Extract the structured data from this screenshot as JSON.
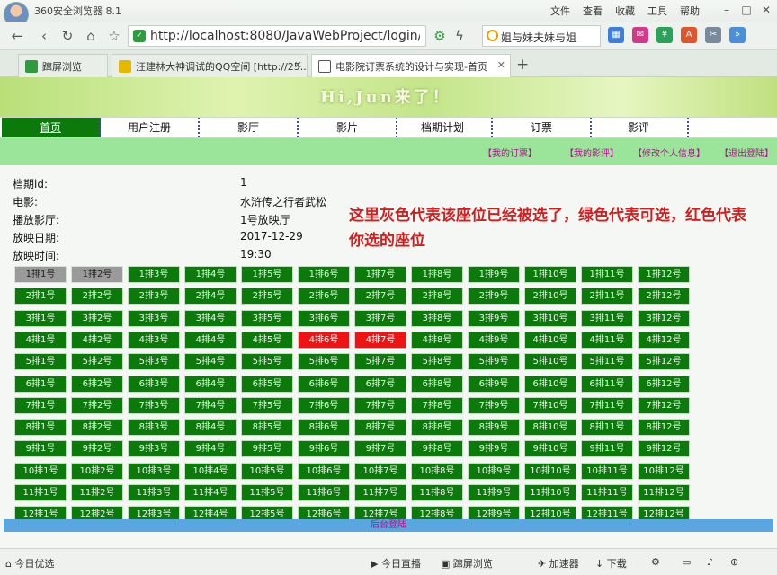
{
  "browser": {
    "app_title": "360安全浏览器 8.1",
    "menu": [
      "文件",
      "查看",
      "收藏",
      "工具",
      "帮助"
    ],
    "address": "http://localhost:8080/JavaWebProject/login/login",
    "search": "姐与妹夫妹与姐",
    "tabs": [
      {
        "label": "蹿屏浏览",
        "icon_color": "#2e9b3e"
      },
      {
        "label": "汪建林大神调试的QQ空间 [http://25...",
        "icon_color": "#e5b800"
      },
      {
        "label": "电影院订票系统的设计与实现-首页",
        "icon_color": "#555555"
      }
    ]
  },
  "page": {
    "greeting": "Hi,Jun来了！",
    "nav": [
      "首页",
      "用户注册",
      "影厅",
      "影片",
      "档期计划",
      "订票",
      "影评"
    ],
    "subnav": [
      "【我的订票】",
      "【我的影评】",
      "【修改个人信息】",
      "【退出登陆】"
    ],
    "info": [
      {
        "label": "档期id:",
        "value": "1"
      },
      {
        "label": "电影:",
        "value": "水浒传之行者武松"
      },
      {
        "label": "播放影厅:",
        "value": "1号放映厅"
      },
      {
        "label": "放映日期:",
        "value": "2017-12-29"
      },
      {
        "label": "放映时间:",
        "value": "19:30"
      }
    ],
    "note": "这里灰色代表该座位已经被选了，绿色代表可选，红色代表你选的座位",
    "seats": {
      "rows": 12,
      "cols": 12,
      "visible_rows": 11,
      "taken": [
        "1-1",
        "1-2"
      ],
      "selected": [
        "4-6",
        "4-7"
      ]
    },
    "backstage_login": "后台登陆"
  },
  "statusbar": {
    "left": "今日优选",
    "items": [
      "今日直播",
      "蹿屏浏览",
      "加速器",
      "下载"
    ]
  },
  "colors": {
    "available": "#0b7a0b",
    "taken": "#9a9a9a",
    "selected": "#ee1414",
    "nav_active": "#0b7a0b",
    "subnav_bg": "#9be59b",
    "link": "#b0108f",
    "note": "#d11f1f"
  }
}
